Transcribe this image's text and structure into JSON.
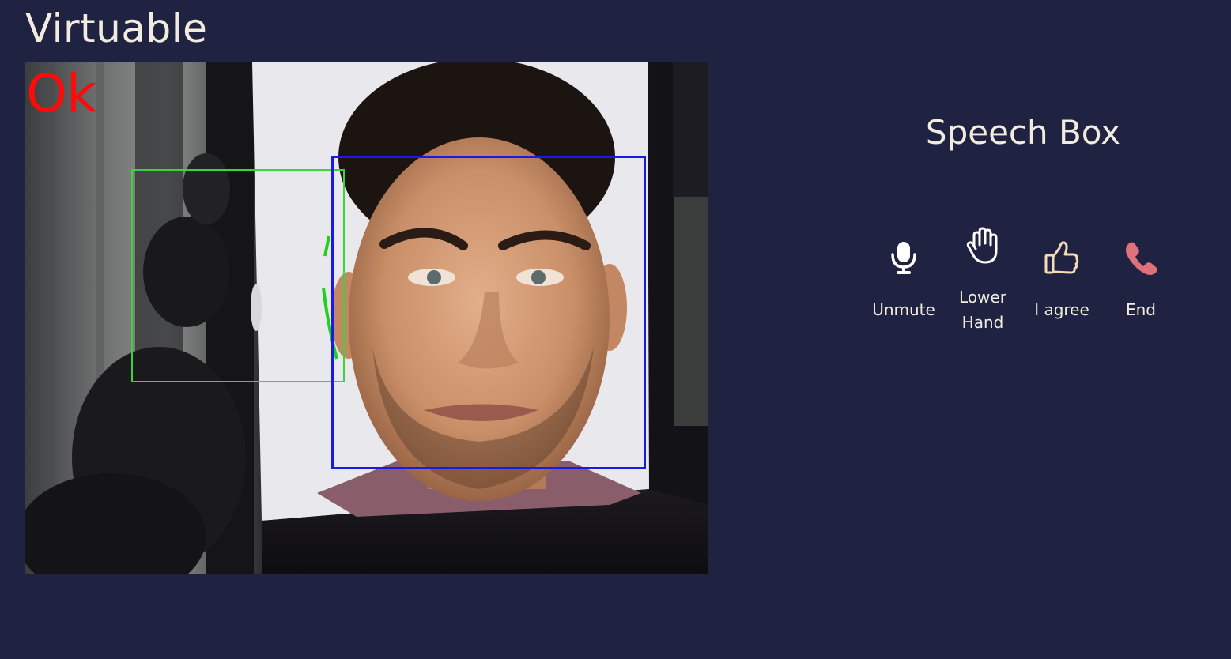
{
  "app": {
    "title": "Virtuable"
  },
  "video": {
    "status_label": "Ok",
    "face_box_color": "#1a1ae6",
    "hand_box_color": "#3fd23f",
    "status_color": "#ff0a0a"
  },
  "speech_box": {
    "title": "Speech Box"
  },
  "controls": [
    {
      "label": "Unmute",
      "icon": "microphone-icon",
      "color": "#ffffff"
    },
    {
      "label": "Lower Hand",
      "icon": "raised-hand-icon",
      "color": "#ffffff"
    },
    {
      "label": "I agree",
      "icon": "thumbs-up-icon",
      "color": "#f3dcb8"
    },
    {
      "label": "End",
      "icon": "phone-icon",
      "color": "#e0707a"
    }
  ],
  "colors": {
    "background": "#1f2240",
    "text": "#f2ece0"
  }
}
